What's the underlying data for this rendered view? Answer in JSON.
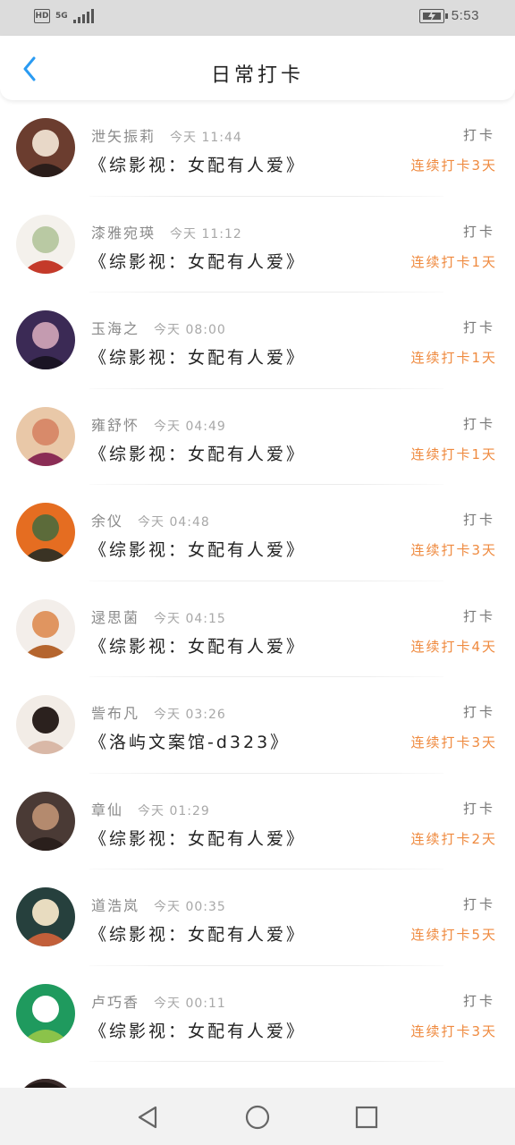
{
  "status_bar": {
    "hd_label": "HD",
    "network_label": "5G",
    "time": "5:53"
  },
  "header": {
    "title": "日常打卡",
    "back_icon": "chevron-left-icon",
    "accent_color": "#2a9bf2"
  },
  "checkins": [
    {
      "user": "泄矢振莉",
      "time": "今天 11:44",
      "book": "《综影视：女配有人爱》",
      "label": "打卡",
      "streak": "连续打卡3天",
      "avatar_colors": [
        "#6b3d2f",
        "#e8d8c8",
        "#2a1d1a"
      ]
    },
    {
      "user": "漆雅宛瑛",
      "time": "今天 11:12",
      "book": "《综影视：女配有人爱》",
      "label": "打卡",
      "streak": "连续打卡1天",
      "avatar_colors": [
        "#f4f1ec",
        "#b9c9a3",
        "#c43a2a"
      ]
    },
    {
      "user": "玉海之",
      "time": "今天 08:00",
      "book": "《综影视：女配有人爱》",
      "label": "打卡",
      "streak": "连续打卡1天",
      "avatar_colors": [
        "#3b2a55",
        "#c49bb0",
        "#1a1424"
      ]
    },
    {
      "user": "雍舒怀",
      "time": "今天 04:49",
      "book": "《综影视：女配有人爱》",
      "label": "打卡",
      "streak": "连续打卡1天",
      "avatar_colors": [
        "#e9c8a8",
        "#d88a6a",
        "#8b2d55"
      ]
    },
    {
      "user": "余仪",
      "time": "今天 04:48",
      "book": "《综影视：女配有人爱》",
      "label": "打卡",
      "streak": "连续打卡3天",
      "avatar_colors": [
        "#e56d21",
        "#5c6b3a",
        "#3a3324"
      ]
    },
    {
      "user": "逯思菌",
      "time": "今天 04:15",
      "book": "《综影视：女配有人爱》",
      "label": "打卡",
      "streak": "连续打卡4天",
      "avatar_colors": [
        "#f3eeea",
        "#e09560",
        "#b5652e"
      ]
    },
    {
      "user": "訾布凡",
      "time": "今天 03:26",
      "book": "《洛屿文案馆-d323》",
      "label": "打卡",
      "streak": "连续打卡3天",
      "avatar_colors": [
        "#f2ece6",
        "#2b211e",
        "#d9b8a7"
      ]
    },
    {
      "user": "章仙",
      "time": "今天 01:29",
      "book": "《综影视：女配有人爱》",
      "label": "打卡",
      "streak": "连续打卡2天",
      "avatar_colors": [
        "#4a3a35",
        "#b48a6e",
        "#2a1f1c"
      ]
    },
    {
      "user": "道浩岚",
      "time": "今天 00:35",
      "book": "《综影视：女配有人爱》",
      "label": "打卡",
      "streak": "连续打卡5天",
      "avatar_colors": [
        "#26403d",
        "#e8dcc0",
        "#c25f3a"
      ]
    },
    {
      "user": "卢巧香",
      "time": "今天 00:11",
      "book": "《综影视：女配有人爱》",
      "label": "打卡",
      "streak": "连续打卡3天",
      "avatar_colors": [
        "#1f9a5e",
        "#ffffff",
        "#8bc34a"
      ]
    }
  ],
  "nav": {
    "back_icon": "triangle-back-icon",
    "home_icon": "circle-home-icon",
    "recents_icon": "square-recents-icon"
  },
  "colors": {
    "streak": "#ef8a3f",
    "title": "#222222",
    "meta": "#8a8a8a"
  }
}
